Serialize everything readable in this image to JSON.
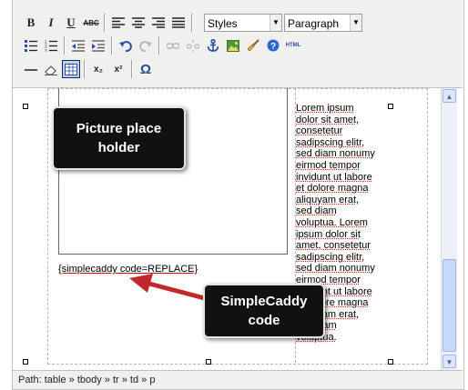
{
  "toolbar": {
    "row1": {
      "bold": "B",
      "italic": "I",
      "underline": "U",
      "strike": "ABC",
      "styles_select": "Styles",
      "format_select": "Paragraph"
    },
    "row2": {
      "html_button": "HTML"
    },
    "row3": {
      "subscript": "x₂",
      "superscript": "x²",
      "charmap": "Ω"
    }
  },
  "editor": {
    "shortcode": "{simplecaddy code=REPLACE}",
    "lorem_text": "Lorem ipsum\ndolor sit amet,\nconsetetur\nsadipscing elitr,\nsed diam nonumy\neirmod tempor\ninvidunt ut labore\net dolore magna\naliquyam erat,\nsed diam\nvoluptua. Lorem\nipsum dolor sit\namet, consetetur\nsadipscing elitr,\nsed diam nonumy\neirmod tempor\ninvidunt ut labore\net dolore magna\naliquyam erat,\nsed diam\nvoluptua."
  },
  "callouts": {
    "picture": "Picture place holder",
    "simplecaddy": "SimpleCaddy code"
  },
  "statusbar": {
    "path": "Path: table » tbody » tr » td » p"
  },
  "colors": {
    "arrow": "#c0282d",
    "callout_bg": "#111111"
  }
}
